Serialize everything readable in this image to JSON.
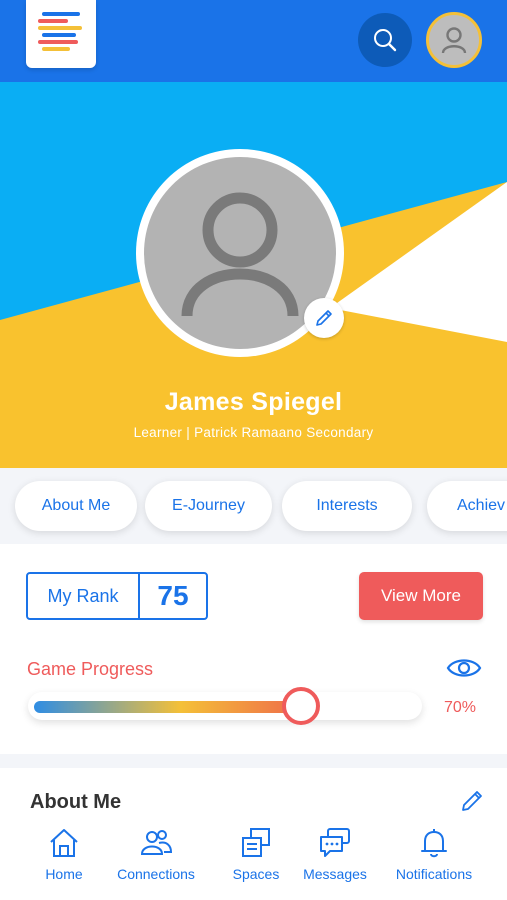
{
  "header": {
    "logo_icon": "menu-logo-icon",
    "search_icon": "search-icon",
    "avatar_icon": "user-avatar-icon"
  },
  "profile": {
    "name": "James Spiegel",
    "subtitle": "Learner | Patrick Ramaano Secondary",
    "photo_icon": "user-placeholder-icon",
    "edit_icon": "pencil-icon"
  },
  "tabs": [
    {
      "label": "About Me"
    },
    {
      "label": "E-Journey"
    },
    {
      "label": "Interests"
    },
    {
      "label": "Achiev"
    }
  ],
  "rank": {
    "label": "My Rank",
    "value": "75"
  },
  "view_more_label": "View More",
  "game_progress": {
    "label": "Game Progress",
    "value_text": "70%",
    "value": 0.7
  },
  "about": {
    "title": "About Me"
  },
  "bottom_nav": [
    {
      "label": "Home",
      "icon": "home-icon"
    },
    {
      "label": "Connections",
      "icon": "connections-icon"
    },
    {
      "label": "Spaces",
      "icon": "spaces-icon"
    },
    {
      "label": "Messages",
      "icon": "messages-icon"
    },
    {
      "label": "Notifications",
      "icon": "bell-icon"
    }
  ],
  "colors": {
    "primary": "#1a73e8",
    "sky": "#0aaef4",
    "yellow": "#f9c22e",
    "accent_red": "#ef5b5b"
  }
}
